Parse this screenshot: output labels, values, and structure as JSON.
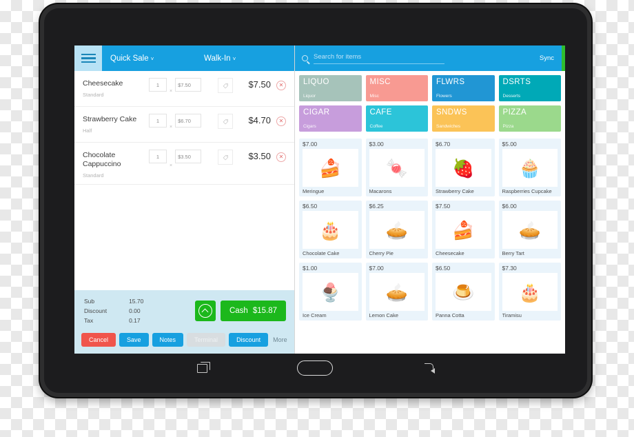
{
  "app": {
    "topbar": {
      "menu_icon": "hamburger-icon",
      "quick_sale_label": "Quick Sale",
      "customer_label": "Walk-In",
      "caret": "˅"
    },
    "search": {
      "icon": "search-icon",
      "placeholder": "Search for items",
      "value": "Search for items"
    },
    "sync_label": "Sync"
  },
  "cart": {
    "items": [
      {
        "name": "Cheesecake",
        "variant": "Standard",
        "qty": "1",
        "unit_price": "$7.50",
        "line_total": "$7.50",
        "tag_icon": "tag-icon",
        "remove_icon": "remove-circle-icon"
      },
      {
        "name": "Strawberry Cake",
        "variant": "Half",
        "qty": "1",
        "unit_price": "$6.70",
        "line_total": "$4.70",
        "tag_icon": "tag-icon",
        "remove_icon": "remove-circle-icon"
      },
      {
        "name": "Chocolate Cappuccino",
        "variant": "Standard",
        "qty": "1",
        "unit_price": "$3.50",
        "line_total": "$3.50",
        "tag_icon": "tag-icon",
        "remove_icon": "remove-circle-icon"
      }
    ],
    "multiply_symbol": "×",
    "totals": [
      {
        "label": "Sub",
        "value": "15.70"
      },
      {
        "label": "Discount",
        "value": "0.00"
      },
      {
        "label": "Tax",
        "value": "0.17"
      }
    ],
    "expand_icon": "chevron-up-circle-icon",
    "pay": {
      "method": "Cash",
      "amount": "$15.87"
    },
    "actions": [
      {
        "label": "Cancel",
        "style": "cancel"
      },
      {
        "label": "Save",
        "style": "blue"
      },
      {
        "label": "Notes",
        "style": "blue"
      },
      {
        "label": "Terminal",
        "style": "disabled"
      },
      {
        "label": "Discount",
        "style": "blue"
      },
      {
        "label": "More",
        "style": "link"
      }
    ]
  },
  "catalog": {
    "categories": [
      {
        "code": "LIQUO",
        "name": "Liquor",
        "color": "#a6c3ba"
      },
      {
        "code": "MISC",
        "name": "Misc",
        "color": "#f89a92"
      },
      {
        "code": "FLWRS",
        "name": "Flowers",
        "color": "#2196d4"
      },
      {
        "code": "DSRTS",
        "name": "Desserts",
        "color": "#00a9b7"
      },
      {
        "code": "CIGAR",
        "name": "Cigars",
        "color": "#c79ddc"
      },
      {
        "code": "CAFE",
        "name": "Coffee",
        "color": "#2cc4d9"
      },
      {
        "code": "SNDWS",
        "name": "Sandwiches",
        "color": "#fbc357"
      },
      {
        "code": "PIZZA",
        "name": "Pizza",
        "color": "#9bd98c"
      }
    ],
    "products": [
      {
        "price": "$7.00",
        "name": "Meringue",
        "glyph": "🍰"
      },
      {
        "price": "$3.00",
        "name": "Macarons",
        "glyph": "🍬"
      },
      {
        "price": "$6.70",
        "name": "Strawberry Cake",
        "glyph": "🍓"
      },
      {
        "price": "$5.00",
        "name": "Raspberries Cupcake",
        "glyph": "🧁"
      },
      {
        "price": "$6.50",
        "name": "Chocolate Cake",
        "glyph": "🎂"
      },
      {
        "price": "$6.25",
        "name": "Cherry Pie",
        "glyph": "🥧"
      },
      {
        "price": "$7.50",
        "name": "Cheesecake",
        "glyph": "🍰"
      },
      {
        "price": "$6.00",
        "name": "Berry Tart",
        "glyph": "🥧"
      },
      {
        "price": "$1.00",
        "name": "Ice Cream",
        "glyph": "🍨"
      },
      {
        "price": "$7.00",
        "name": "Lemon Cake",
        "glyph": "🥧"
      },
      {
        "price": "$6.50",
        "name": "Panna Cotta",
        "glyph": "🍮"
      },
      {
        "price": "$7.30",
        "name": "Tiramisu",
        "glyph": "🎂"
      }
    ]
  },
  "device": {
    "nav": {
      "recent_icon": "recent-apps-icon",
      "home_icon": "home-button-icon",
      "back_icon": "back-arrow-icon"
    }
  }
}
